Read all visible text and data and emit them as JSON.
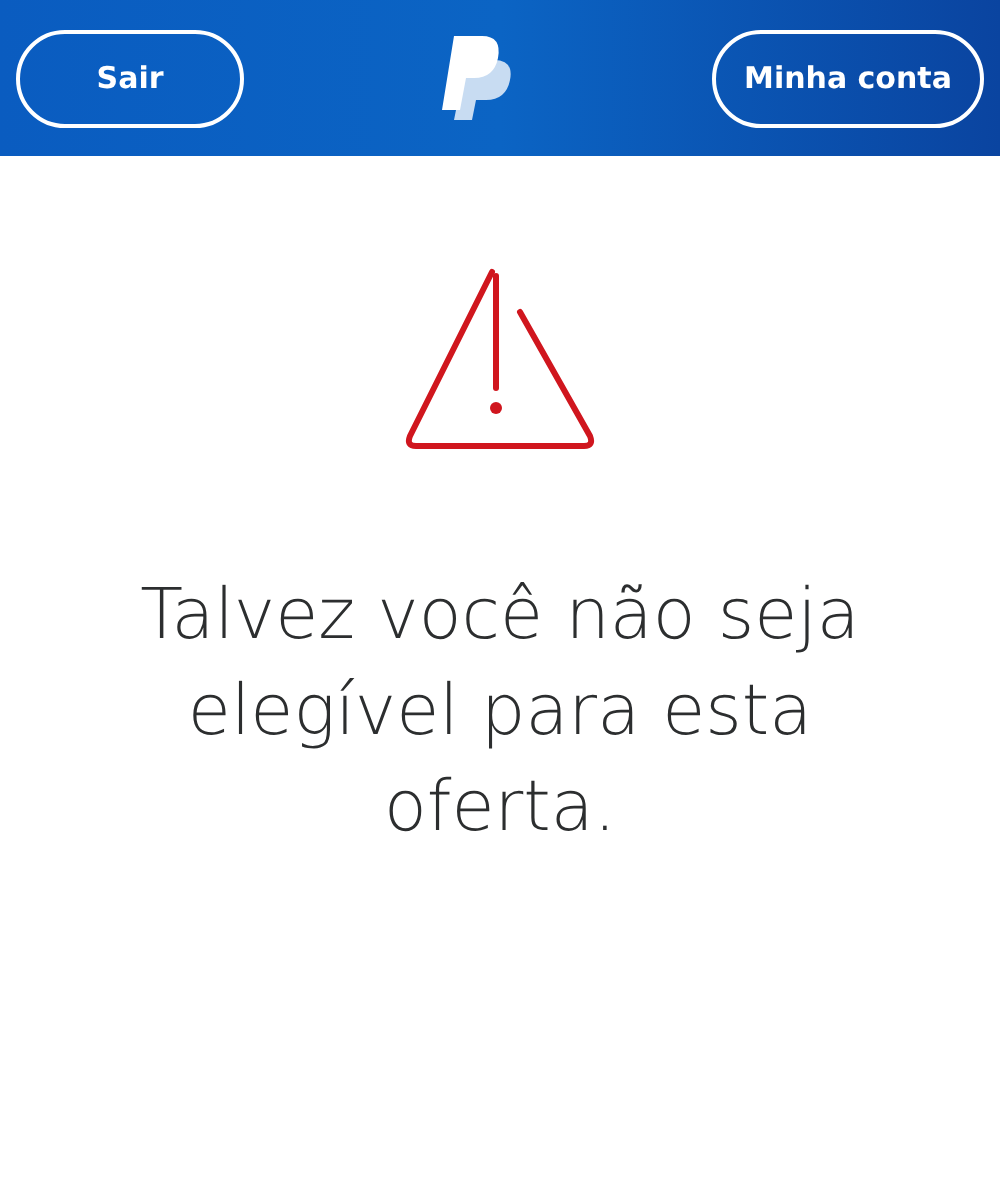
{
  "header": {
    "left_button": "Sair",
    "right_button": "Minha conta"
  },
  "message": "Talvez você não seja elegível para esta oferta."
}
